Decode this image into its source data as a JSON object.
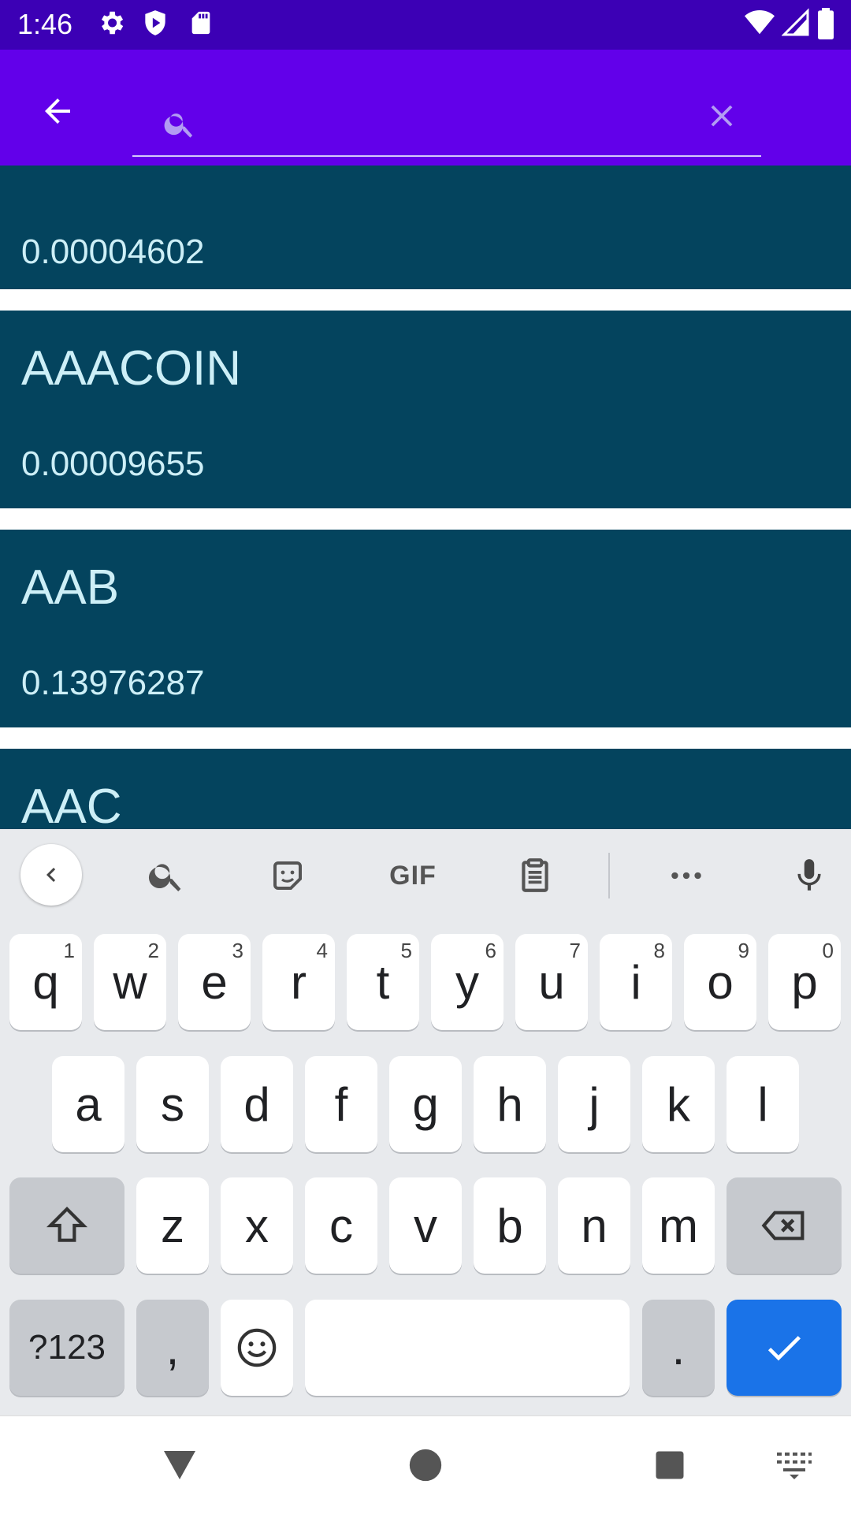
{
  "status_bar": {
    "time": "1:46",
    "icons": [
      "settings-icon",
      "shield-icon",
      "sd-card-icon",
      "wifi-icon",
      "signal-icon",
      "battery-icon"
    ]
  },
  "app_bar": {
    "color": "#6200ea",
    "search": {
      "value": "",
      "placeholder": ""
    }
  },
  "coins": [
    {
      "name": "",
      "price": "0.00004602"
    },
    {
      "name": "AAACOIN",
      "price": "0.00009655"
    },
    {
      "name": "AAB",
      "price": "0.13976287"
    },
    {
      "name": "AAC",
      "price": ""
    }
  ],
  "keyboard": {
    "toolbar": [
      "back-chevron-icon",
      "search-icon",
      "sticker-icon",
      "gif-icon",
      "clipboard-icon",
      "more-icon",
      "microphone-icon"
    ],
    "gif_label": "GIF",
    "row1": [
      {
        "k": "q",
        "h": "1"
      },
      {
        "k": "w",
        "h": "2"
      },
      {
        "k": "e",
        "h": "3"
      },
      {
        "k": "r",
        "h": "4"
      },
      {
        "k": "t",
        "h": "5"
      },
      {
        "k": "y",
        "h": "6"
      },
      {
        "k": "u",
        "h": "7"
      },
      {
        "k": "i",
        "h": "8"
      },
      {
        "k": "o",
        "h": "9"
      },
      {
        "k": "p",
        "h": "0"
      }
    ],
    "row2": [
      "a",
      "s",
      "d",
      "f",
      "g",
      "h",
      "j",
      "k",
      "l"
    ],
    "row3": [
      "z",
      "x",
      "c",
      "v",
      "b",
      "n",
      "m"
    ],
    "symbols_label": "?123",
    "comma_label": ",",
    "period_label": ".",
    "accent": "#1a73e8"
  },
  "nav_bar": {
    "icons": [
      "back-triangle-icon",
      "home-circle-icon",
      "recents-square-icon",
      "keyboard-switch-icon"
    ]
  }
}
